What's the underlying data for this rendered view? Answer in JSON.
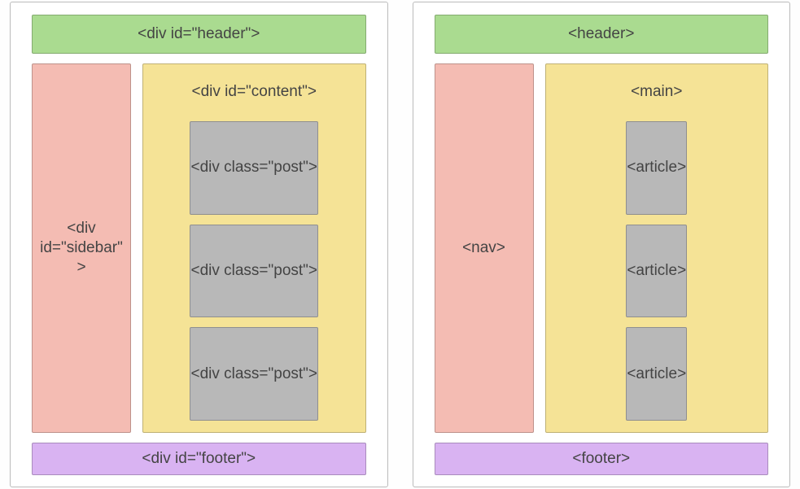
{
  "left": {
    "header": "<div id=\"header\">",
    "sidebar": "<div id=\"sidebar\">",
    "content": "<div id=\"content\">",
    "posts": [
      "<div class=\"post\">",
      "<div class=\"post\">",
      "<div class=\"post\">"
    ],
    "footer": "<div id=\"footer\">"
  },
  "right": {
    "header": "<header>",
    "sidebar": "<nav>",
    "content": "<main>",
    "posts": [
      "<article>",
      "<article>",
      "<article>"
    ],
    "footer": "<footer>"
  }
}
